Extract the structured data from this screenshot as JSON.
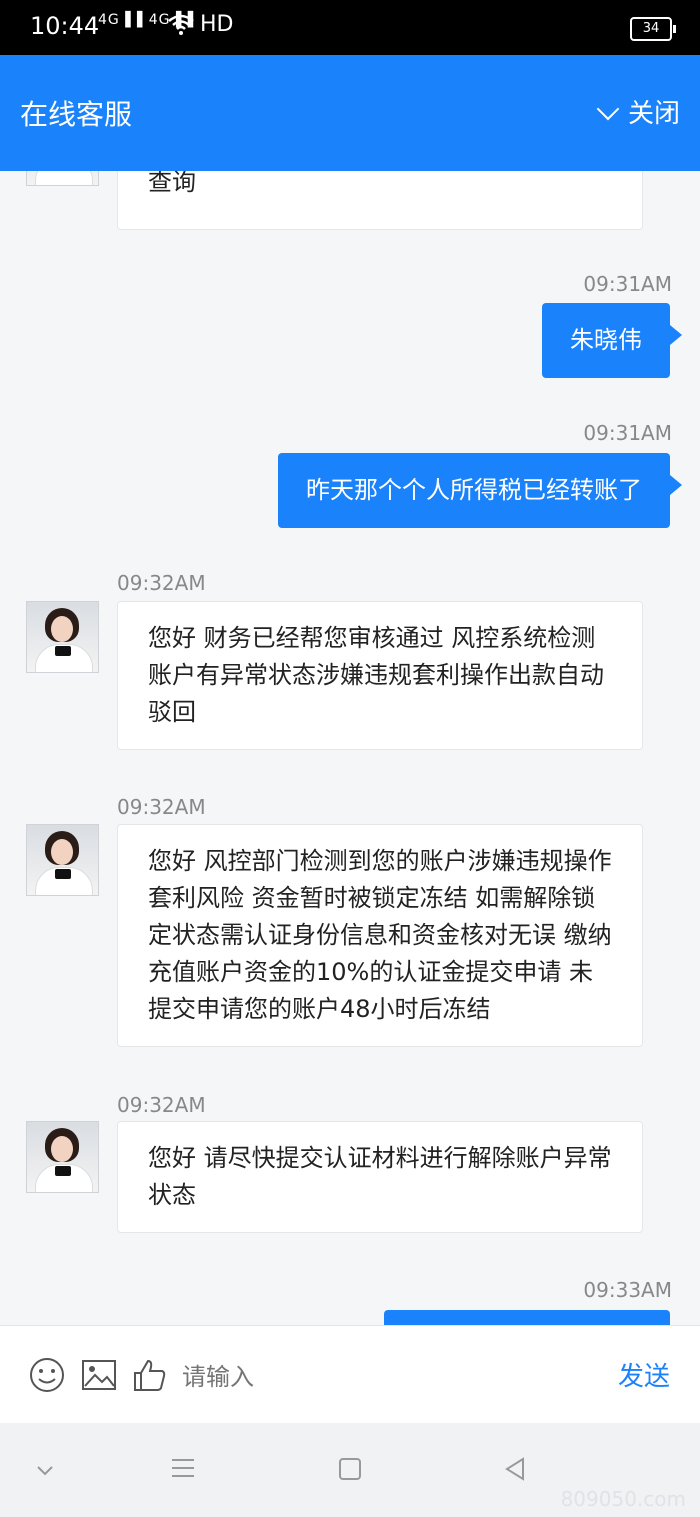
{
  "status_bar": {
    "time": "10:44",
    "signal1": "4G",
    "signal2": "4G",
    "network": "HD",
    "battery": "34"
  },
  "header": {
    "title": "在线客服",
    "close_label": "关闭"
  },
  "messages": [
    {
      "sender": "agent",
      "time": "",
      "text": "查询"
    },
    {
      "sender": "user",
      "time": "09:31AM",
      "text": "朱晓伟"
    },
    {
      "sender": "user",
      "time": "09:31AM",
      "text": "昨天那个个人所得税已经转账了"
    },
    {
      "sender": "agent",
      "time": "09:32AM",
      "text": "您好 财务已经帮您审核通过 风控系统检测账户有异常状态涉嫌违规套利操作出款自动驳回"
    },
    {
      "sender": "agent",
      "time": "09:32AM",
      "text": "您好 风控部门检测到您的账户涉嫌违规操作套利风险 资金暂时被锁定冻结 如需解除锁定状态需认证身份信息和资金核对无误 缴纳充值账户资金的10%的认证金提交申请 未提交申请您的账户48小时后冻结"
    },
    {
      "sender": "agent",
      "time": "09:32AM",
      "text": "您好 请尽快提交认证材料进行解除账户异常状态"
    },
    {
      "sender": "user",
      "time": "09:33AM",
      "text": ""
    }
  ],
  "input_bar": {
    "placeholder": "请输入",
    "send_label": "发送"
  },
  "watermark": "809050.com",
  "colors": {
    "accent": "#1a82fb",
    "background": "#f5f6f8"
  }
}
